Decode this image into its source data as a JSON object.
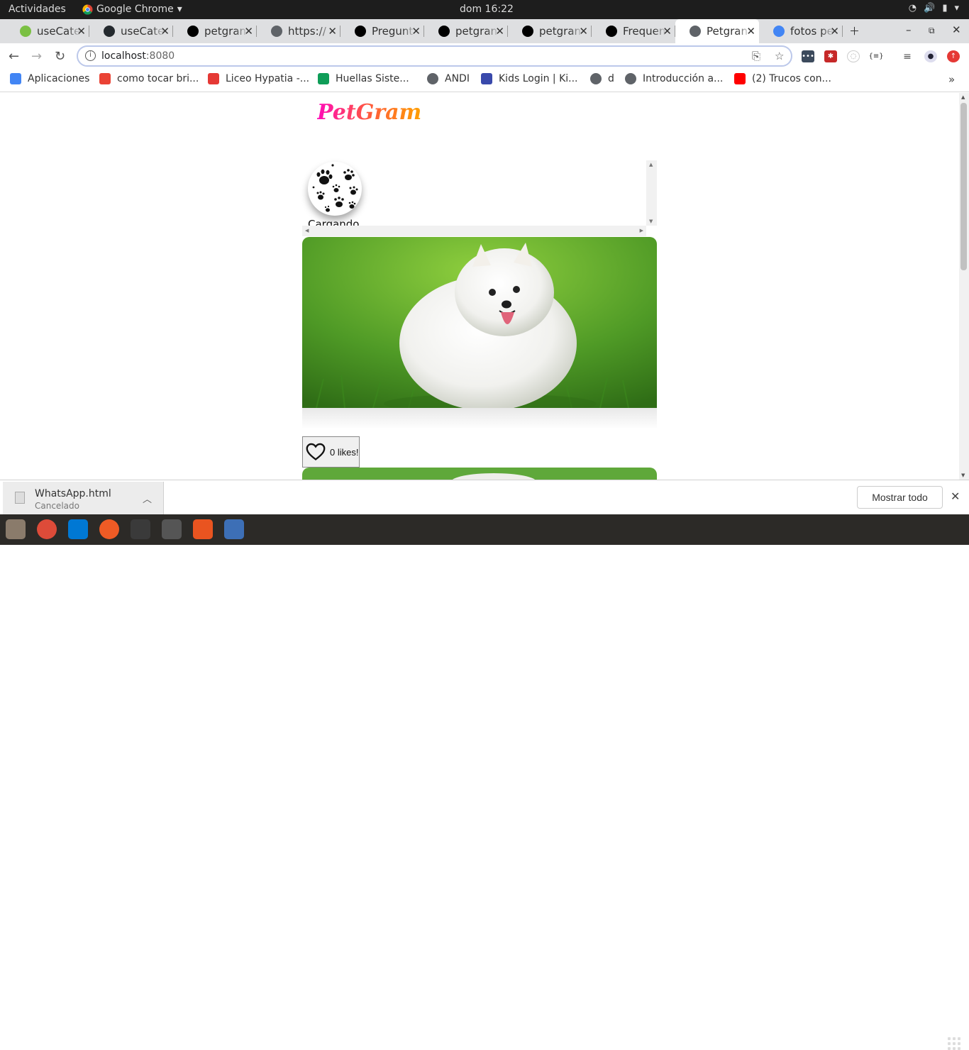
{
  "system_bar": {
    "activities": "Actividades",
    "app_name": "Google Chrome",
    "clock": "dom 16:22"
  },
  "tabs": [
    {
      "label": "useCate",
      "icon": "green-diamond-icon",
      "color": "#7bc043"
    },
    {
      "label": "useCate",
      "icon": "github-icon",
      "color": "#24292e"
    },
    {
      "label": "petgran",
      "icon": "nextjs-icon",
      "color": "#000000"
    },
    {
      "label": "https://",
      "icon": "globe-icon",
      "color": "#5f6368"
    },
    {
      "label": "Pregunt",
      "icon": "nextjs-icon",
      "color": "#000000"
    },
    {
      "label": "petgran",
      "icon": "nextjs-icon",
      "color": "#000000"
    },
    {
      "label": "petgran",
      "icon": "nextjs-icon",
      "color": "#000000"
    },
    {
      "label": "Frequen",
      "icon": "nextjs-icon",
      "color": "#000000"
    },
    {
      "label": "Petgran",
      "icon": "globe-icon",
      "color": "#5f6368",
      "active": true
    },
    {
      "label": "fotos pe",
      "icon": "google-icon",
      "color": "#4285f4"
    }
  ],
  "address_bar": {
    "host": "localhost",
    "port": ":8080"
  },
  "bookmarks": [
    {
      "label": "Aplicaciones",
      "icon": "apps-grid-icon",
      "color": "#4285f4"
    },
    {
      "label": "como tocar bri...",
      "icon": "google-icon",
      "color": "#ea4335"
    },
    {
      "label": "Liceo Hypatia -...",
      "icon": "hypatia-icon",
      "color": "#e53935"
    },
    {
      "label": "Huellas Siste...",
      "icon": "s-icon",
      "color": "#0f9d58"
    },
    {
      "label": "ANDI",
      "icon": "globe-icon",
      "color": "#5f6368"
    },
    {
      "label": "Kids Login | Ki...",
      "icon": "kids-icon",
      "color": "#3949ab"
    },
    {
      "label": "d",
      "icon": "globe-icon",
      "color": "#5f6368"
    },
    {
      "label": "Introducción a...",
      "icon": "globe-icon",
      "color": "#5f6368"
    },
    {
      "label": "(2) Trucos con...",
      "icon": "youtube-icon",
      "color": "#ff0000"
    }
  ],
  "page": {
    "logo": "PetGram",
    "category_label": "Cargando...",
    "likes_label": "0 likes!"
  },
  "download_bar": {
    "file_name": "WhatsApp.html",
    "status": "Cancelado",
    "show_all": "Mostrar todo"
  },
  "dock": [
    {
      "name": "files-icon",
      "color": "#8a7b6b"
    },
    {
      "name": "chrome-icon",
      "color": "#dd4b39"
    },
    {
      "name": "vscode-icon",
      "color": "#0078d4"
    },
    {
      "name": "postman-icon",
      "color": "#ef5b25"
    },
    {
      "name": "terminal-icon",
      "color": "#3a3a3a"
    },
    {
      "name": "tools-icon",
      "color": "#555555"
    },
    {
      "name": "software-center-icon",
      "color": "#e95420"
    },
    {
      "name": "screenshot-icon",
      "color": "#3d6fb6"
    }
  ]
}
